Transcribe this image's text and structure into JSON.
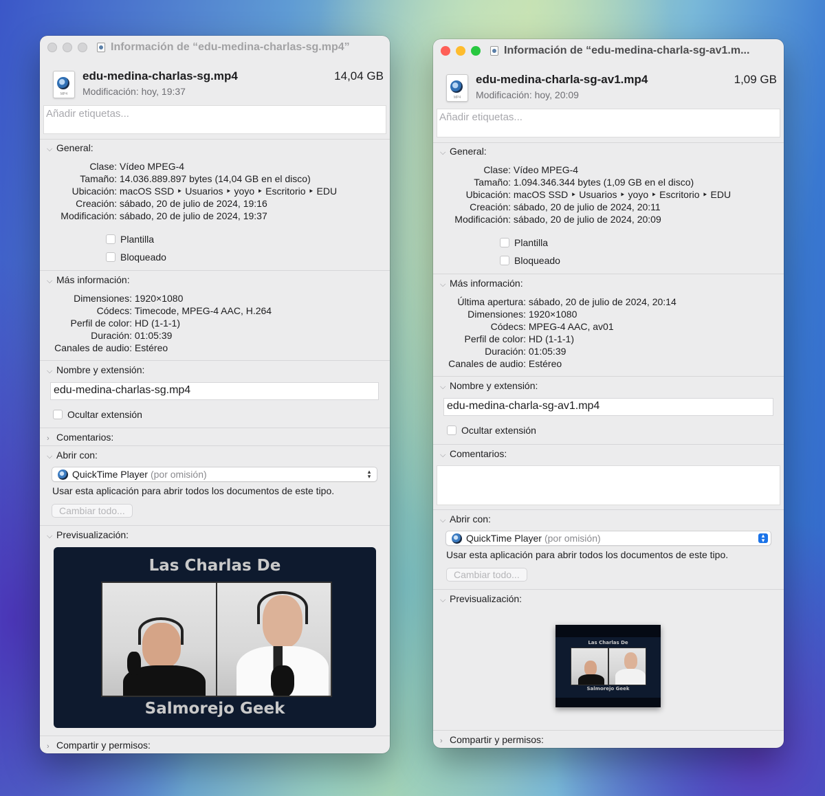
{
  "left": {
    "title": "Información de “edu-medina-charlas-sg.mp4”",
    "file_name": "edu-medina-charlas-sg.mp4",
    "file_size": "14,04 GB",
    "modified_short": "Modificación: hoy, 19:37",
    "icon_ext": "MP4",
    "tags_placeholder": "Añadir etiquetas...",
    "general": {
      "header": "General:",
      "rows": [
        {
          "k": "Clase:",
          "v": "Vídeo MPEG-4"
        },
        {
          "k": "Tamaño:",
          "v": "14.036.889.897 bytes (14,04 GB en el disco)"
        },
        {
          "k": "Ubicación:",
          "v": "macOS SSD ‣ Usuarios ‣ yoyo ‣ Escritorio ‣ EDU"
        },
        {
          "k": "Creación:",
          "v": "sábado, 20 de julio de 2024, 19:16"
        },
        {
          "k": "Modificación:",
          "v": "sábado, 20 de julio de 2024, 19:37"
        }
      ],
      "template": "Plantilla",
      "locked": "Bloqueado"
    },
    "more": {
      "header": "Más información:",
      "rows": [
        {
          "k": "Dimensiones:",
          "v": "1920×1080"
        },
        {
          "k": "Códecs:",
          "v": "Timecode, MPEG-4 AAC, H.264"
        },
        {
          "k": "Perfil de color:",
          "v": "HD (1-1-1)"
        },
        {
          "k": "Duración:",
          "v": "01:05:39"
        },
        {
          "k": "Canales de audio:",
          "v": "Estéreo"
        }
      ]
    },
    "name_ext": {
      "header": "Nombre y extensión:",
      "value": "edu-medina-charlas-sg.mp4",
      "hide_ext": "Ocultar extensión"
    },
    "comments": {
      "header": "Comentarios:"
    },
    "open_with": {
      "header": "Abrir con:",
      "app": "QuickTime Player",
      "default_note": "(por omisión)",
      "note": "Usar esta aplicación para abrir todos los documentos de este tipo.",
      "change_all": "Cambiar todo..."
    },
    "preview": {
      "header": "Previsualización:",
      "top_text": "Las Charlas De",
      "bottom_text": "Salmorejo Geek"
    },
    "sharing": {
      "header": "Compartir y permisos:"
    }
  },
  "right": {
    "title": "Información de “edu-medina-charla-sg-av1.m...",
    "file_name": "edu-medina-charla-sg-av1.mp4",
    "file_size": "1,09 GB",
    "modified_short": "Modificación: hoy, 20:09",
    "icon_ext": "MP4",
    "tags_placeholder": "Añadir etiquetas...",
    "general": {
      "header": "General:",
      "rows": [
        {
          "k": "Clase:",
          "v": "Vídeo MPEG-4"
        },
        {
          "k": "Tamaño:",
          "v": "1.094.346.344 bytes (1,09 GB en el disco)"
        },
        {
          "k": "Ubicación:",
          "v": "macOS SSD ‣ Usuarios ‣ yoyo ‣ Escritorio ‣ EDU"
        },
        {
          "k": "Creación:",
          "v": "sábado, 20 de julio de 2024, 20:11"
        },
        {
          "k": "Modificación:",
          "v": "sábado, 20 de julio de 2024, 20:09"
        }
      ],
      "template": "Plantilla",
      "locked": "Bloqueado"
    },
    "more": {
      "header": "Más información:",
      "rows": [
        {
          "k": "Última apertura:",
          "v": "sábado, 20 de julio de 2024, 20:14"
        },
        {
          "k": "Dimensiones:",
          "v": "1920×1080"
        },
        {
          "k": "Códecs:",
          "v": "MPEG-4 AAC, av01"
        },
        {
          "k": "Perfil de color:",
          "v": "HD (1-1-1)"
        },
        {
          "k": "Duración:",
          "v": "01:05:39"
        },
        {
          "k": "Canales de audio:",
          "v": "Estéreo"
        }
      ]
    },
    "name_ext": {
      "header": "Nombre y extensión:",
      "value": "edu-medina-charla-sg-av1.mp4",
      "hide_ext": "Ocultar extensión"
    },
    "comments": {
      "header": "Comentarios:"
    },
    "open_with": {
      "header": "Abrir con:",
      "app": "QuickTime Player",
      "default_note": "(por omisión)",
      "note": "Usar esta aplicación para abrir todos los documentos de este tipo.",
      "change_all": "Cambiar todo..."
    },
    "preview": {
      "header": "Previsualización:",
      "top_text": "Las Charlas De",
      "bottom_text": "Salmorejo Geek"
    },
    "sharing": {
      "header": "Compartir y permisos:"
    }
  },
  "colors": {
    "close": "#fe5f57",
    "minimize": "#febc2e",
    "maximize": "#28c840",
    "window_bg": "#ececed",
    "popup_accent": "#1a73e8",
    "preview_bg": "#0e1a2e"
  }
}
